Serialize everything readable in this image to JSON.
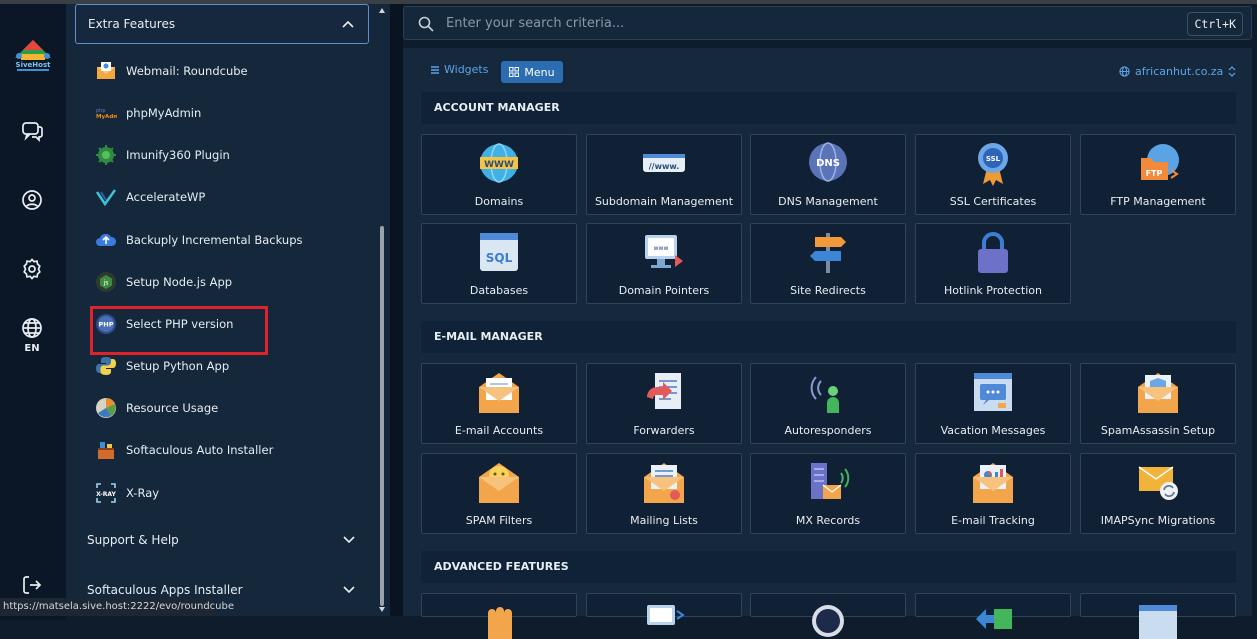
{
  "sidebar": {
    "open_section": "Extra Features",
    "items": [
      {
        "label": "Webmail: Roundcube",
        "icon": "roundcube-icon"
      },
      {
        "label": "phpMyAdmin",
        "icon": "phpmyadmin-icon"
      },
      {
        "label": "Imunify360 Plugin",
        "icon": "imunify-icon"
      },
      {
        "label": "AccelerateWP",
        "icon": "acceleratewp-icon"
      },
      {
        "label": "Backuply Incremental Backups",
        "icon": "backuply-icon"
      },
      {
        "label": "Setup Node.js App",
        "icon": "nodejs-icon"
      },
      {
        "label": "Select PHP version",
        "icon": "php-icon"
      },
      {
        "label": "Setup Python App",
        "icon": "python-icon"
      },
      {
        "label": "Resource Usage",
        "icon": "resource-usage-icon"
      },
      {
        "label": "Softaculous Auto Installer",
        "icon": "softaculous-icon"
      },
      {
        "label": "X-Ray",
        "icon": "xray-icon"
      }
    ],
    "collapsed_sections": [
      "Support & Help",
      "Softaculous Apps Installer"
    ]
  },
  "rail": {
    "logo_text": "SiveHost",
    "lang": "EN"
  },
  "search": {
    "placeholder": "Enter your search criteria...",
    "shortcut": "Ctrl+K"
  },
  "toolbar": {
    "widgets_label": "Widgets",
    "menu_label": "Menu",
    "domain": "africanhut.co.za"
  },
  "status_url": "https://matsela.sive.host:2222/evo/roundcube",
  "categories": [
    {
      "title": "ACCOUNT MANAGER",
      "tiles": [
        "Domains",
        "Subdomain Management",
        "DNS Management",
        "SSL Certificates",
        "FTP Management",
        "Databases",
        "Domain Pointers",
        "Site Redirects",
        "Hotlink Protection"
      ]
    },
    {
      "title": "E-MAIL MANAGER",
      "tiles": [
        "E-mail Accounts",
        "Forwarders",
        "Autoresponders",
        "Vacation Messages",
        "SpamAssassin Setup",
        "SPAM Filters",
        "Mailing Lists",
        "MX Records",
        "E-mail Tracking",
        "IMAPSync Migrations"
      ]
    },
    {
      "title": "ADVANCED FEATURES",
      "tiles": []
    }
  ],
  "colors": {
    "accent": "#2b6cb3",
    "highlight": "#e0232a",
    "link": "#5ba4e8"
  }
}
